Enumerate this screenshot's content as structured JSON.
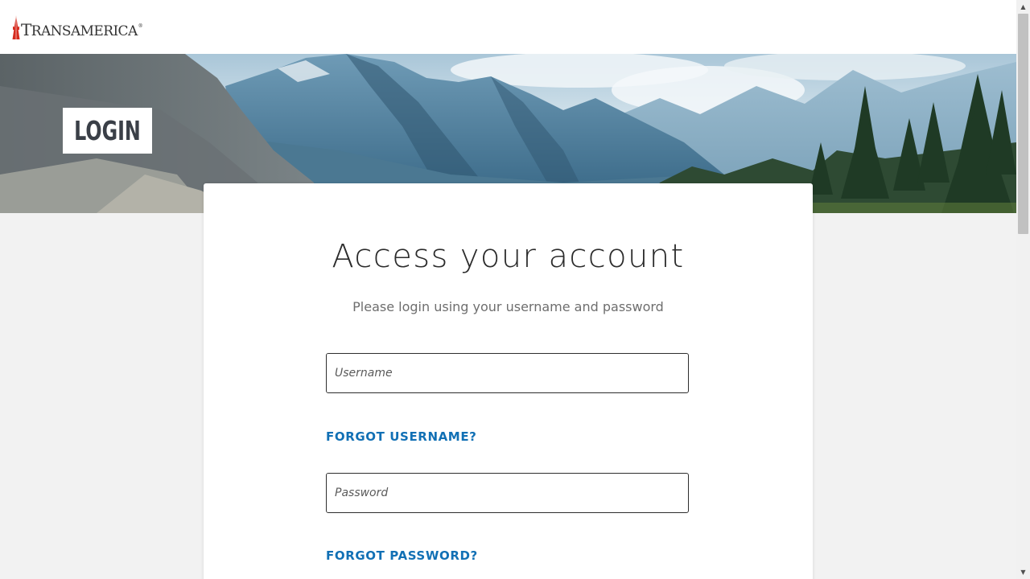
{
  "header": {
    "logo_text_first": "T",
    "logo_text_rest": "RANSAMERICA",
    "logo_mark": "®",
    "logo_icon": "pyramid-icon"
  },
  "hero": {
    "badge_label": "LOGIN",
    "image": "mountain-landscape"
  },
  "card": {
    "title": "Access your account",
    "subtitle": "Please login using your username and password",
    "username_placeholder": "Username",
    "username_value": "",
    "forgot_username": "FORGOT USERNAME?",
    "password_placeholder": "Password",
    "password_value": "",
    "forgot_password": "FORGOT PASSWORD?"
  },
  "colors": {
    "link": "#1170b5",
    "brand_red": "#d52b1e",
    "page_bg": "#f2f2f2"
  },
  "scrollbar": {
    "up_icon": "▲",
    "down_icon": "▼"
  }
}
